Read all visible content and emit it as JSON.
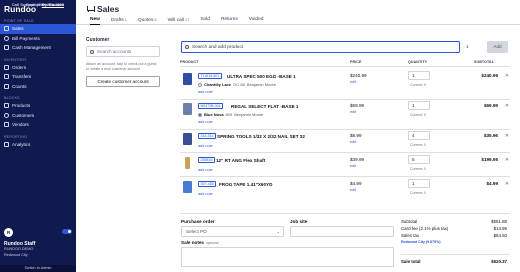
{
  "brand": {
    "logo": "Rundoo",
    "support": "Call Support (650) 394-2205",
    "explore_prefix": "Explore ",
    "explore_link": "the Rundoo"
  },
  "sidebar": {
    "sections": [
      {
        "title": "POINT OF SALE",
        "items": [
          {
            "label": "Sales",
            "icon": "cart-icon",
            "active": true
          },
          {
            "label": "Bill Payments",
            "icon": "dollar-icon"
          },
          {
            "label": "Cash Management",
            "icon": "cash-icon"
          }
        ]
      },
      {
        "title": "INVENTORY",
        "items": [
          {
            "label": "Orders",
            "icon": "orders-icon"
          },
          {
            "label": "Transfers",
            "icon": "transfer-icon"
          },
          {
            "label": "Counts",
            "icon": "counts-icon"
          }
        ]
      },
      {
        "title": "BLOCKS",
        "items": [
          {
            "label": "Products",
            "icon": "products-icon"
          },
          {
            "label": "Customers",
            "icon": "customers-icon"
          },
          {
            "label": "Vendors",
            "icon": "vendors-icon"
          }
        ]
      },
      {
        "title": "REPORTING",
        "items": [
          {
            "label": "Analytics",
            "icon": "analytics-icon"
          }
        ]
      }
    ],
    "user": {
      "initials": "R",
      "name": "Rundoo Staff",
      "org": "RUNDOO DEMO",
      "location": "Redwood City",
      "switch_label": "Switch to Admin"
    }
  },
  "header": {
    "title": "Sales",
    "tabs": [
      {
        "label": "New",
        "count": "",
        "active": true
      },
      {
        "label": "Drafts",
        "count": "1"
      },
      {
        "label": "Quotes",
        "count": "6"
      },
      {
        "label": "Will call",
        "count": "17"
      },
      {
        "label": "Sold",
        "count": ""
      },
      {
        "label": "Returns",
        "count": ""
      },
      {
        "label": "Voided",
        "count": ""
      }
    ]
  },
  "customer": {
    "heading": "Customer",
    "search_placeholder": "Search accounts",
    "hint": "Attach an account, skip to check out a guest, or create a new customer account",
    "create_button": "Create customer account"
  },
  "product_search": {
    "placeholder": "Search and add product",
    "qty": "1",
    "add_label": "Add"
  },
  "table": {
    "headers": {
      "product": "PRODUCT",
      "price": "PRICE",
      "quantity": "QUANTITY",
      "subtotal": "SUBTOTAL"
    },
    "add_note": "add note",
    "edit": "edit",
    "current_prefix": "Current: ",
    "rows": [
      {
        "sku": "T1W19-501",
        "name": "ULTRA SPEC 500 EGG -BASE 1",
        "color_name": "Chantilly Lace",
        "color_code": "OC-65",
        "color_brand": "Benjamin Moore",
        "swatch": "#f6f3ea",
        "price": "$240.99",
        "qty": "1",
        "current": "0",
        "subtotal": "$240.99",
        "thumb": "#2d4ea3"
      },
      {
        "sku": "N0472B-001",
        "name": "REGAL SELECT FLAT -BASE 1",
        "color_name": "Blue Nova",
        "color_code": "825",
        "color_brand": "Benjamin Moore",
        "swatch": "#5b6eb0",
        "price": "$69.99",
        "qty": "1",
        "current": "0",
        "subtotal": "$69.99",
        "thumb": "#6a7fa8"
      },
      {
        "sku": "316-011",
        "name": "SPRING TOOLS 1/32 X 2/32 NAIL SET 32",
        "color_name": "",
        "color_code": "",
        "color_brand": "",
        "swatch": "",
        "price": "$8.99",
        "qty": "4",
        "current": "0",
        "subtotal": "$35.96",
        "thumb": "#3a4f8f"
      },
      {
        "sku": "255815",
        "name": "12\" RT ANG Flex Shaft",
        "color_name": "",
        "color_code": "",
        "color_brand": "",
        "swatch": "",
        "price": "$39.99",
        "qty": "5",
        "current": "0",
        "subtotal": "$199.95",
        "thumb": "#c9a15a"
      },
      {
        "sku": "397-450",
        "name": "FROG TAPE 1.41\"X60YD",
        "color_name": "",
        "color_code": "",
        "color_brand": "",
        "swatch": "",
        "price": "$4.99",
        "qty": "1",
        "current": "0",
        "subtotal": "$4.99",
        "thumb": "#4a7bd1"
      }
    ]
  },
  "footer": {
    "purchase_order_label": "Purchase order",
    "po_placeholder": "Select PO",
    "job_site_label": "Job site",
    "notes_label": "Sale notes",
    "notes_optional": "optional",
    "totals": {
      "subtotal_label": "Subtotal",
      "subtotal": "$551.88",
      "card_fee_label": "Card fee (2.1% plus tax)",
      "card_fee": "$13.99",
      "tax_label": "Sales tax",
      "tax": "$54.50",
      "tax_detail": "Redwood City (9.875%)",
      "total_label": "Sale total",
      "total": "$620.37"
    }
  }
}
